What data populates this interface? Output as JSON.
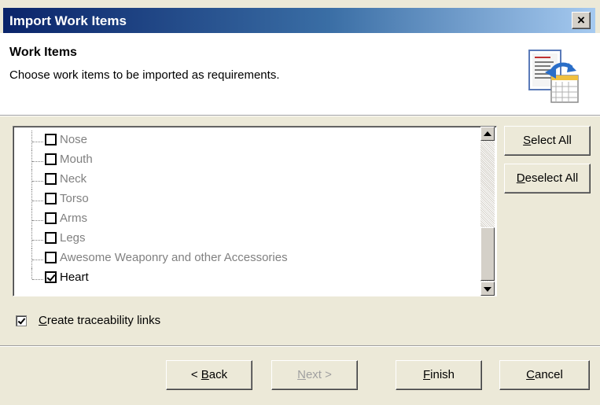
{
  "window": {
    "title": "Import Work Items",
    "close_label": "×"
  },
  "header": {
    "title": "Work Items",
    "subtitle": "Choose work items to be imported as requirements.",
    "icon": "import-requirements-icon"
  },
  "work_items": [
    {
      "label": "Nose",
      "checked": false,
      "enabled": false
    },
    {
      "label": "Mouth",
      "checked": false,
      "enabled": false
    },
    {
      "label": "Neck",
      "checked": false,
      "enabled": false
    },
    {
      "label": "Torso",
      "checked": false,
      "enabled": false
    },
    {
      "label": "Arms",
      "checked": false,
      "enabled": false
    },
    {
      "label": "Legs",
      "checked": false,
      "enabled": false
    },
    {
      "label": "Awesome Weaponry and other Accessories",
      "checked": false,
      "enabled": false
    },
    {
      "label": "Heart",
      "checked": true,
      "enabled": true
    }
  ],
  "side_buttons": {
    "select_all": {
      "mnemonic": "S",
      "rest": "elect All"
    },
    "deselect_all": {
      "mnemonic": "D",
      "rest": "eselect All"
    }
  },
  "traceability": {
    "checked": true,
    "mnemonic": "C",
    "rest": "reate traceability links"
  },
  "footer": {
    "back": {
      "pre": "< ",
      "mnemonic": "B",
      "rest": "ack",
      "enabled": true
    },
    "next": {
      "pre": "",
      "mnemonic": "N",
      "rest": "ext >",
      "enabled": false
    },
    "finish": {
      "pre": "",
      "mnemonic": "F",
      "rest": "inish",
      "enabled": true
    },
    "cancel": {
      "pre": "",
      "mnemonic": "C",
      "rest": "ancel",
      "enabled": true
    }
  }
}
